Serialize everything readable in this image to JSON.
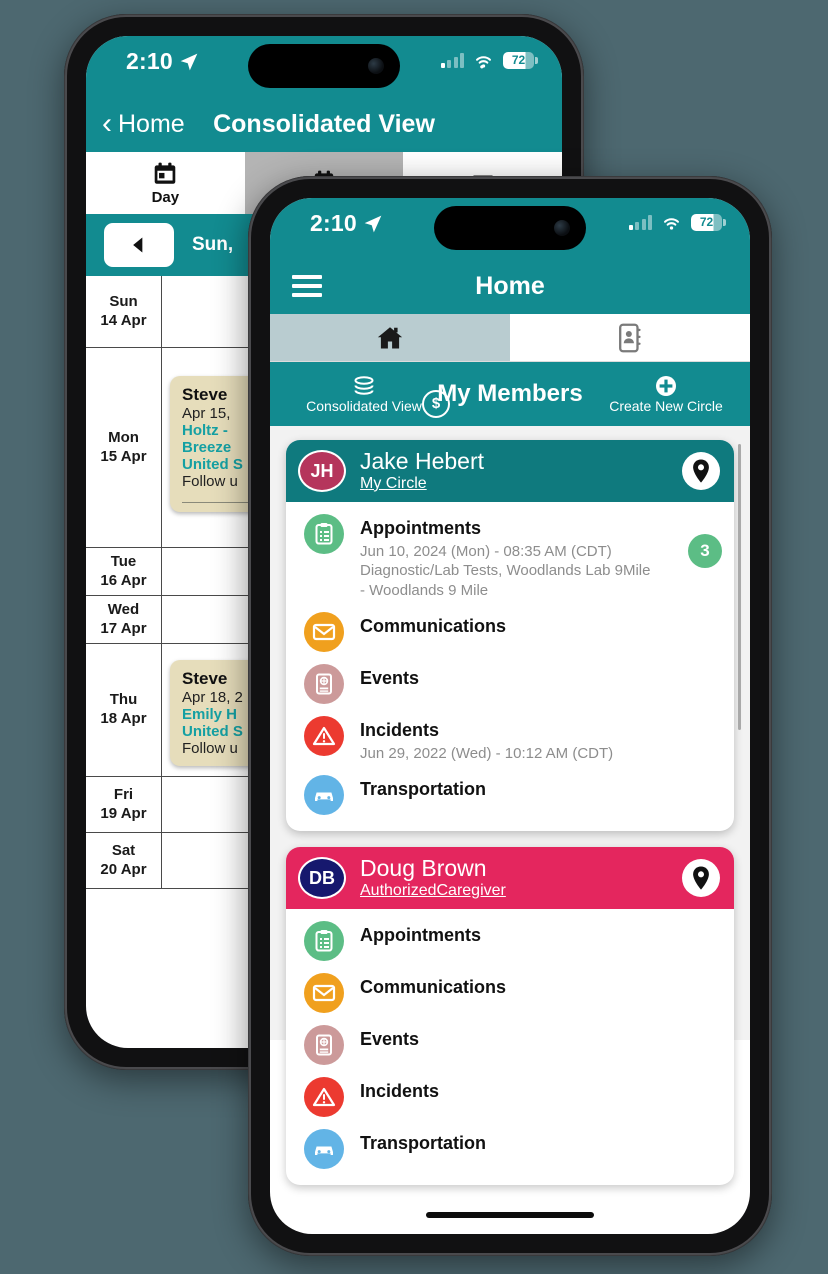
{
  "background_color": "#4d6870",
  "accent_teal": "#128b90",
  "back_phone": {
    "status_bar": {
      "time": "2:10",
      "battery": "72",
      "location_icon": "location-arrow-icon",
      "signal_icon": "cellular-bars-icon",
      "wifi_icon": "wifi-icon"
    },
    "nav": {
      "back_label": "Home",
      "title": "Consolidated View"
    },
    "view_tabs": [
      {
        "label": "Day",
        "icon": "calendar-day-icon",
        "active": false
      },
      {
        "label": "",
        "icon": "calendar-week-icon",
        "active": true
      },
      {
        "label": "",
        "icon": "filter-funnel-icon",
        "active": false
      }
    ],
    "date_row": {
      "prev_icon": "triangle-left-icon",
      "range": "Sun,"
    },
    "calendar_rows": [
      {
        "day": "Sun",
        "date": "14 Apr",
        "events": []
      },
      {
        "day": "Mon",
        "date": "15 Apr",
        "events": [
          {
            "title": "Steve ",
            "date": "Apr 15, ",
            "line1": " Holtz -",
            "line2": "Breeze ",
            "line3": "United S",
            "footer": "Follow u"
          }
        ]
      },
      {
        "day": "Tue",
        "date": "16 Apr",
        "events": []
      },
      {
        "day": "Wed",
        "date": "17 Apr",
        "events": []
      },
      {
        "day": "Thu",
        "date": "18 Apr",
        "events": [
          {
            "title": "Steve ",
            "date": "Apr 18, 2",
            "line1": "",
            "line2": "Emily H",
            "line3": "United S",
            "footer": "Follow u"
          }
        ]
      },
      {
        "day": "Fri",
        "date": "19 Apr",
        "events": []
      },
      {
        "day": "Sat",
        "date": "20 Apr",
        "events": []
      }
    ]
  },
  "front_phone": {
    "status_bar": {
      "time": "2:10",
      "battery": "72",
      "location_icon": "location-arrow-icon",
      "signal_icon": "cellular-bars-icon",
      "wifi_icon": "wifi-icon"
    },
    "nav": {
      "menu_icon": "hamburger-menu-icon",
      "title": "Home"
    },
    "main_tabs": [
      {
        "icon": "home-icon",
        "active": true
      },
      {
        "icon": "contacts-book-icon",
        "active": false
      }
    ],
    "action_bar": {
      "left_label": "Consolidated View",
      "left_icon": "layers-stack-icon",
      "left_badge": "$",
      "title": "My Members",
      "right_label": "Create New Circle",
      "right_icon": "plus-circle-icon"
    },
    "members": [
      {
        "initials": "JH",
        "name": "Jake Hebert",
        "role": "My Circle",
        "header_color": "#0f7a7e",
        "avatar_color": "#b5355c",
        "pin_icon": "map-pin-icon",
        "rows": [
          {
            "title": "Appointments",
            "sub": "Jun 10, 2024 (Mon) - 08:35 AM (CDT)\nDiagnostic/Lab Tests, Woodlands Lab 9Mile - Woodlands 9 Mile",
            "icon": "clipboard-icon",
            "icon_color": "#5cbd85",
            "count": "3"
          },
          {
            "title": "Communications",
            "sub": "",
            "icon": "envelope-icon",
            "icon_color": "#f0a01e",
            "count": ""
          },
          {
            "title": "Events",
            "sub": "",
            "icon": "event-book-icon",
            "icon_color": "#cc9a9a",
            "count": ""
          },
          {
            "title": "Incidents",
            "sub": "Jun 29, 2022 (Wed) - 10:12 AM (CDT)",
            "icon": "warning-triangle-icon",
            "icon_color": "#ec3a30",
            "count": ""
          },
          {
            "title": "Transportation",
            "sub": "",
            "icon": "car-icon",
            "icon_color": "#62b4e6",
            "count": ""
          }
        ]
      },
      {
        "initials": "DB",
        "name": "Doug Brown",
        "role": "AuthorizedCaregiver",
        "header_color": "#e4265e",
        "avatar_color": "#16186e",
        "pin_icon": "map-pin-icon",
        "rows": [
          {
            "title": "Appointments",
            "sub": "",
            "icon": "clipboard-icon",
            "icon_color": "#5cbd85",
            "count": ""
          },
          {
            "title": "Communications",
            "sub": "",
            "icon": "envelope-icon",
            "icon_color": "#f0a01e",
            "count": ""
          },
          {
            "title": "Events",
            "sub": "",
            "icon": "event-book-icon",
            "icon_color": "#cc9a9a",
            "count": ""
          },
          {
            "title": "Incidents",
            "sub": "",
            "icon": "warning-triangle-icon",
            "icon_color": "#ec3a30",
            "count": ""
          },
          {
            "title": "Transportation",
            "sub": "",
            "icon": "car-icon",
            "icon_color": "#62b4e6",
            "count": ""
          }
        ]
      }
    ]
  }
}
